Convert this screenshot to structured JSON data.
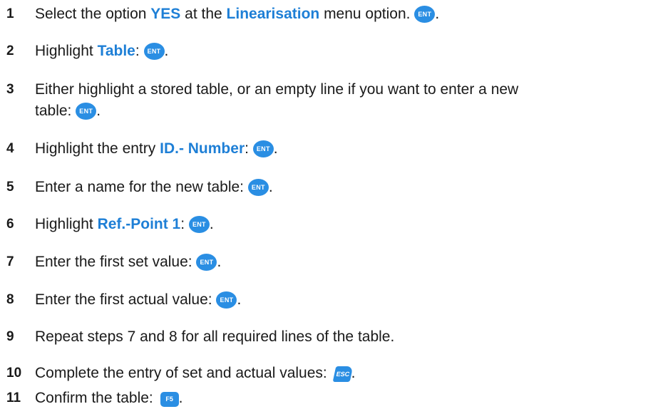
{
  "keys": {
    "ent": "ENT",
    "esc": "ESC",
    "f5": "F5"
  },
  "steps": [
    {
      "num": "1",
      "a": "Select the option ",
      "b": "YES",
      "c": " at the ",
      "d": "Linearisation",
      "e": " menu option. "
    },
    {
      "num": "2",
      "a": "Highlight ",
      "b": "Table",
      "c": ": "
    },
    {
      "num": "3",
      "a": "Either highlight a stored table, or an empty line if you want to enter a new",
      "b": "table: "
    },
    {
      "num": "4",
      "a": "Highlight the entry ",
      "b": "ID.- Number",
      "c": ": "
    },
    {
      "num": "5",
      "a": "Enter a name for the new table: "
    },
    {
      "num": "6",
      "a": "Highlight ",
      "b": "Ref.-Point 1",
      "c": ": "
    },
    {
      "num": "7",
      "a": "Enter the first set value: "
    },
    {
      "num": "8",
      "a": "Enter the first actual value: "
    },
    {
      "num": "9",
      "a": "Repeat steps 7 and 8 for all required lines of the table."
    },
    {
      "num": "10",
      "a": "Complete the entry of set and actual values: "
    },
    {
      "num": "11",
      "a": "Confirm the table: "
    }
  ]
}
